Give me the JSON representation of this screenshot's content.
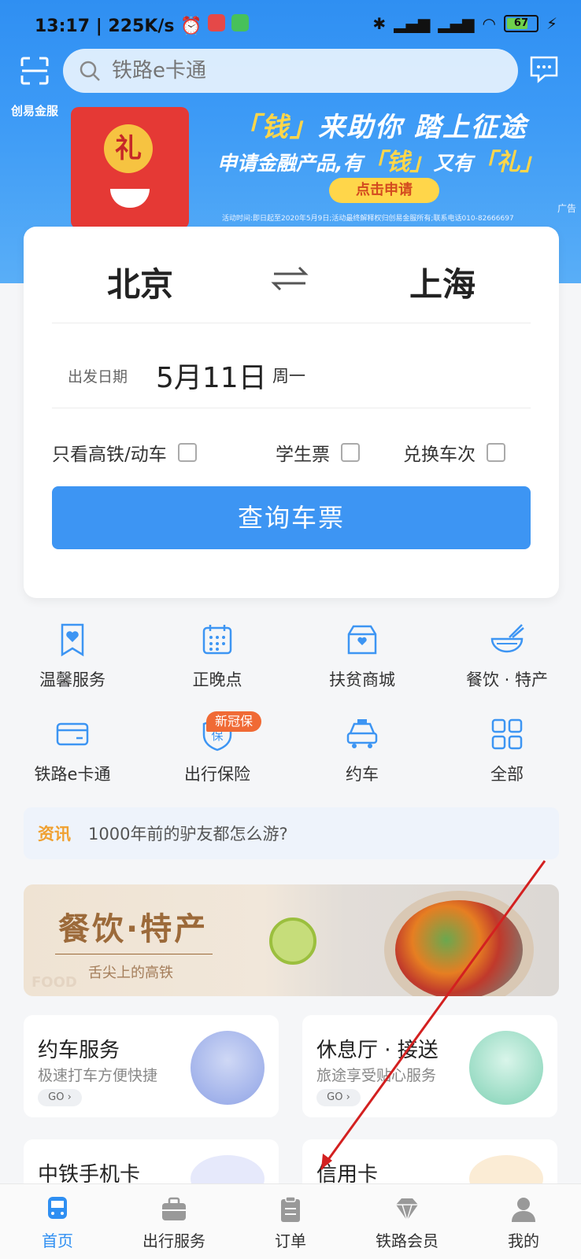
{
  "status_bar": {
    "time": "13:17",
    "speed": "225K/s",
    "battery": "67"
  },
  "search": {
    "placeholder": "铁路e卡通"
  },
  "banner": {
    "brand": "创易金服",
    "title_a": "「钱」",
    "title_b": "来助你 踏上征途",
    "sub_a": "申请金融产品,有",
    "sub_b": "「钱」",
    "sub_c": "又有",
    "sub_d": "「礼」",
    "seal": "礼",
    "button": "点击申请",
    "fine_print": "活动时间:即日起至2020年5月9日;活动最终解释权归创易金服所有;联系电话010-82666697",
    "ad_label": "广告"
  },
  "ticket": {
    "from_city": "北京",
    "to_city": "上海",
    "date_label": "出发日期",
    "date_value": "5月11日",
    "weekday": "周一",
    "options": [
      "只看高铁/动车",
      "学生票",
      "兑换车次"
    ],
    "search_button": "查询车票"
  },
  "grid": {
    "items": [
      {
        "label": "温馨服务",
        "icon": "heart-bookmark-icon"
      },
      {
        "label": "正晚点",
        "icon": "calendar-icon"
      },
      {
        "label": "扶贫商城",
        "icon": "shop-icon"
      },
      {
        "label": "餐饮 · 特产",
        "icon": "noodle-bowl-icon"
      },
      {
        "label": "铁路e卡通",
        "icon": "card-icon"
      },
      {
        "label": "出行保险",
        "icon": "shield-icon"
      },
      {
        "label": "约车",
        "icon": "car-icon"
      },
      {
        "label": "全部",
        "icon": "grid-icon"
      }
    ],
    "new_tag": "新冠保"
  },
  "news": {
    "tag": "资讯",
    "text": "1000年前的驴友都怎么游?"
  },
  "food_banner": {
    "title": "餐饮·特产",
    "subtitle": "舌尖上的高铁",
    "en": "FOOD"
  },
  "services": [
    {
      "title": "约车服务",
      "sub": "极速打车方便快捷",
      "go": "GO ›"
    },
    {
      "title": "休息厅 · 接送",
      "sub": "旅途享受贴心服务",
      "go": "GO ›"
    },
    {
      "title": "中铁手机卡",
      "sub": "",
      "go": ""
    },
    {
      "title": "信用卡",
      "sub": "",
      "go": ""
    }
  ],
  "bottom_nav": [
    {
      "label": "首页",
      "icon": "train-icon",
      "active": true
    },
    {
      "label": "出行服务",
      "icon": "briefcase-icon",
      "active": false
    },
    {
      "label": "订单",
      "icon": "clipboard-icon",
      "active": false
    },
    {
      "label": "铁路会员",
      "icon": "diamond-icon",
      "active": false
    },
    {
      "label": "我的",
      "icon": "person-icon",
      "active": false
    }
  ],
  "colors": {
    "primary": "#3d95f3",
    "accent_orange": "#f06a35",
    "news_tag": "#f0a030"
  }
}
